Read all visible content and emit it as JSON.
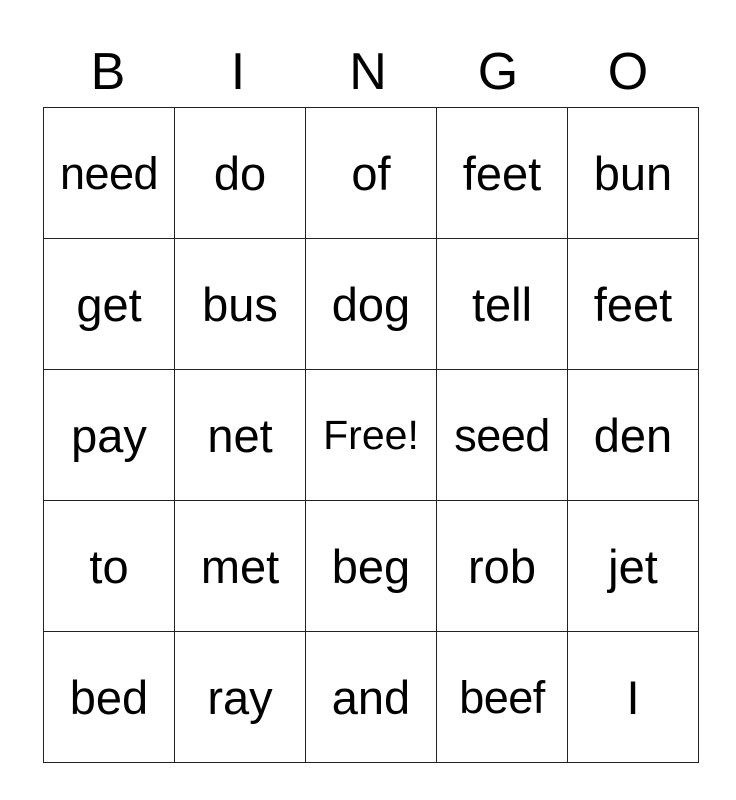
{
  "header": [
    "B",
    "I",
    "N",
    "G",
    "O"
  ],
  "rows": [
    [
      "need",
      "do",
      "of",
      "feet",
      "bun"
    ],
    [
      "get",
      "bus",
      "dog",
      "tell",
      "feet"
    ],
    [
      "pay",
      "net",
      "Free!",
      "seed",
      "den"
    ],
    [
      "to",
      "met",
      "beg",
      "rob",
      "jet"
    ],
    [
      "bed",
      "ray",
      "and",
      "beef",
      "I"
    ]
  ],
  "free_space": {
    "row": 2,
    "col": 2,
    "label": "Free!"
  }
}
